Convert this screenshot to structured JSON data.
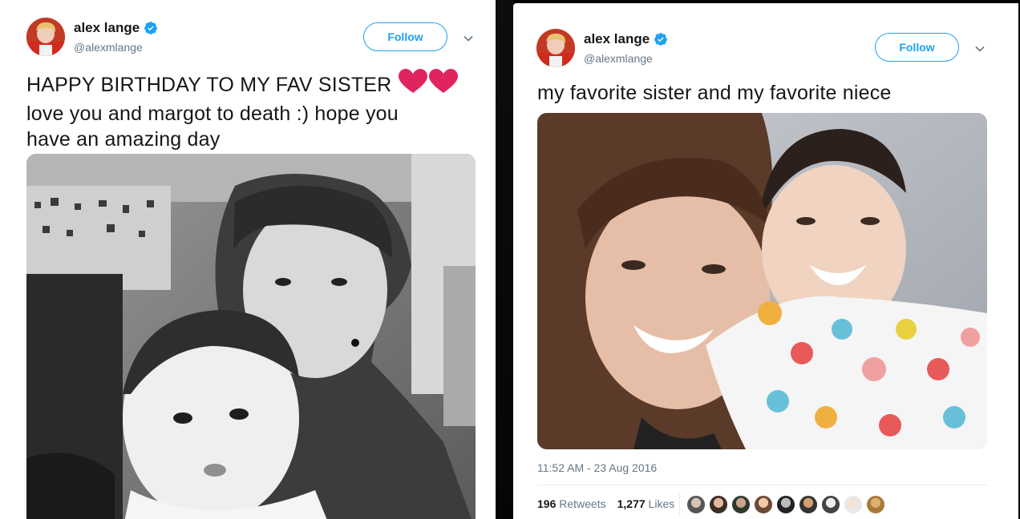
{
  "left_tweet": {
    "display_name": "alex lange",
    "handle": "@alexmlange",
    "follow_label": "Follow",
    "text_line1": "HAPPY BIRTHDAY TO MY FAV SISTER",
    "text_line2": "love you and margot to death :) hope you",
    "text_line3": "have an amazing day",
    "hearts": "❤❤"
  },
  "right_tweet": {
    "display_name": "alex lange",
    "handle": "@alexmlange",
    "follow_label": "Follow",
    "text": "my favorite sister and my favorite niece",
    "timestamp": "11:52 AM - 23 Aug 2016",
    "retweets_count": "196",
    "retweets_label": "Retweets",
    "likes_count": "1,277",
    "likes_label": "Likes"
  },
  "colors": {
    "accent": "#1da1f2",
    "verified": "#1da1f2",
    "heart": "#e0245e",
    "text": "#14171a",
    "muted": "#657786"
  },
  "icons": [
    "verified-badge-icon",
    "chevron-down-icon",
    "heart-icon"
  ]
}
